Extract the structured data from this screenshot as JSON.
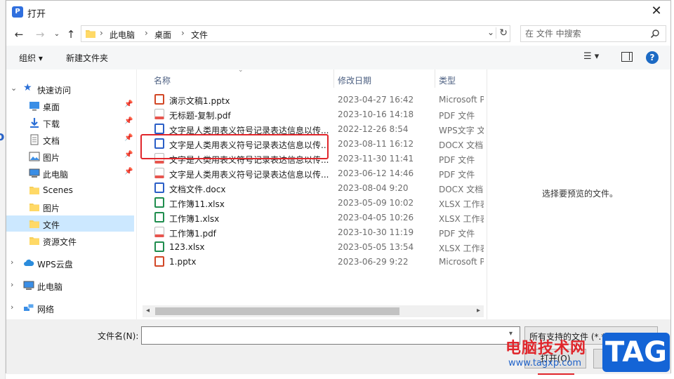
{
  "window": {
    "title": "打开"
  },
  "address": {
    "crumbs": [
      "此电脑",
      "桌面",
      "文件"
    ]
  },
  "search": {
    "placeholder": "在 文件 中搜索"
  },
  "toolbar": {
    "organize": "组织 ▾",
    "new_folder": "新建文件夹"
  },
  "nav": {
    "quick_access": "快速访问",
    "items": [
      {
        "label": "桌面",
        "icon": "desktop-icon"
      },
      {
        "label": "下载",
        "icon": "download-icon"
      },
      {
        "label": "文档",
        "icon": "document-icon"
      },
      {
        "label": "图片",
        "icon": "pictures-icon"
      },
      {
        "label": "此电脑",
        "icon": "computer-icon"
      },
      {
        "label": "Scenes",
        "icon": "folder-icon"
      },
      {
        "label": "图片",
        "icon": "folder-icon"
      },
      {
        "label": "文件",
        "icon": "folder-icon"
      },
      {
        "label": "资源文件",
        "icon": "folder-icon"
      }
    ],
    "wps_cloud": "WPS云盘",
    "this_pc": "此电脑",
    "network": "网络"
  },
  "columns": {
    "name": "名称",
    "date": "修改日期",
    "type": "类型"
  },
  "files": [
    {
      "name": "演示文稿1.pptx",
      "date": "2023-04-27 16:42",
      "type": "Microsoft PowerPoint",
      "kind": "pptx"
    },
    {
      "name": "无标题-复制.pdf",
      "date": "2023-10-16 14:18",
      "type": "PDF 文件",
      "kind": "pdf"
    },
    {
      "name": "文字是人类用表义符号记录表达信息以传...",
      "date": "2022-12-26 8:54",
      "type": "WPS文字 文档",
      "kind": "wps"
    },
    {
      "name": "文字是人类用表义符号记录表达信息以传...",
      "date": "2023-08-11 16:12",
      "type": "DOCX 文档",
      "kind": "docx"
    },
    {
      "name": "文字是人类用表义符号记录表达信息以传...",
      "date": "2023-11-30 11:41",
      "type": "PDF 文件",
      "kind": "pdf"
    },
    {
      "name": "文字是人类用表义符号记录表达信息以传...",
      "date": "2023-06-12 14:46",
      "type": "PDF 文件",
      "kind": "pdf"
    },
    {
      "name": "文档文件.docx",
      "date": "2023-08-04 9:20",
      "type": "DOCX 文档",
      "kind": "docx"
    },
    {
      "name": "工作簿11.xlsx",
      "date": "2023-05-09 10:02",
      "type": "XLSX 工作表",
      "kind": "xlsx"
    },
    {
      "name": "工作簿1.xlsx",
      "date": "2023-04-05 10:26",
      "type": "XLSX 工作表",
      "kind": "xlsx"
    },
    {
      "name": "工作簿1.pdf",
      "date": "2023-10-30 11:19",
      "type": "PDF 文件",
      "kind": "pdf"
    },
    {
      "name": "123.xlsx",
      "date": "2023-05-05 13:54",
      "type": "XLSX 工作表",
      "kind": "xlsx"
    },
    {
      "name": "1.pptx",
      "date": "2023-06-29 9:22",
      "type": "Microsoft PowerPoint",
      "kind": "pptx"
    }
  ],
  "preview": {
    "text": "选择要预览的文件。"
  },
  "bottom": {
    "filename_label": "文件名(N):",
    "filename_value": "",
    "filetype": "所有支持的文件 (*.*)",
    "open": "打开(O)",
    "cancel": "取消"
  },
  "watermark": {
    "site": "电脑技术网",
    "url": "www.tagxp.com",
    "badge": "TAG"
  },
  "colors": {
    "pptx": "#d24726",
    "pdf": "#e8554e",
    "wps": "#2b5fc7",
    "docx": "#2b5fc7",
    "xlsx": "#1f8d4e",
    "selection": "#cce8ff",
    "highlight": "#e0262b"
  }
}
